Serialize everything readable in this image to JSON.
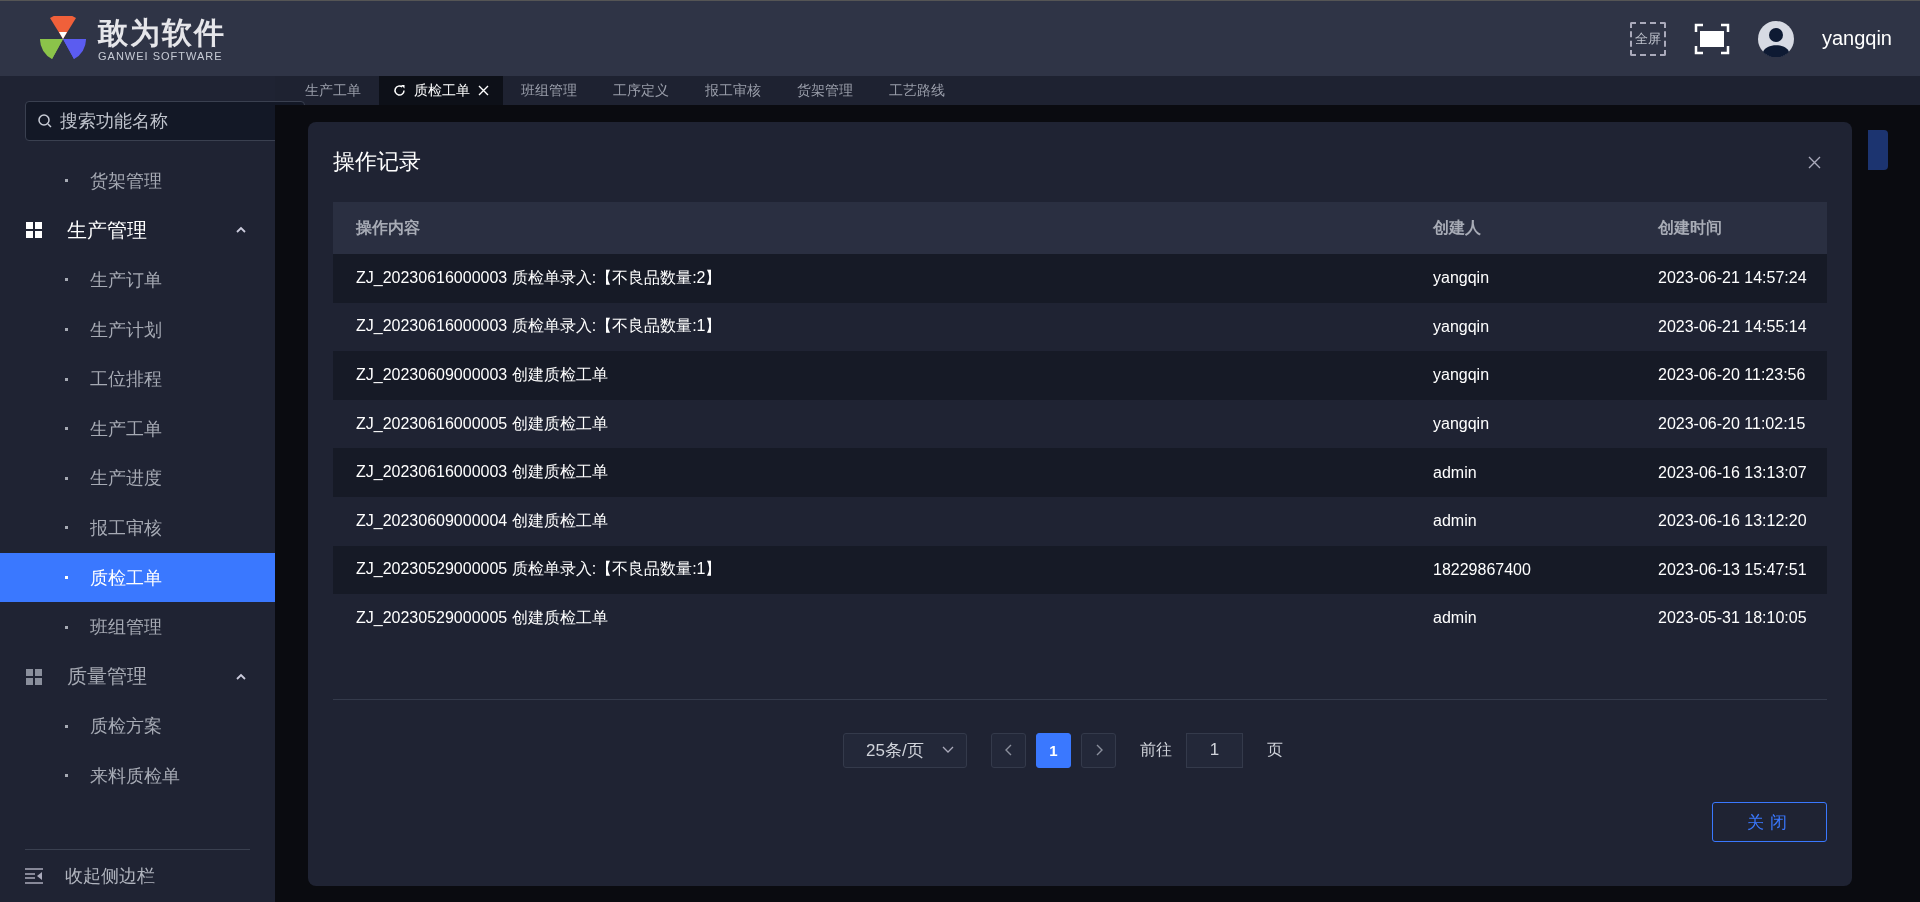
{
  "header": {
    "logo_title": "敢为软件",
    "logo_subtitle": "GANWEI SOFTWARE",
    "fullscreen_label": "全屏",
    "username": "yangqin"
  },
  "sidebar": {
    "search_placeholder": "搜索功能名称",
    "items": [
      {
        "kind": "leaf",
        "label": "货架管理",
        "selected": false
      },
      {
        "kind": "group",
        "label": "生产管理",
        "active": true,
        "expanded": true,
        "children": [
          {
            "kind": "leaf",
            "label": "生产订单",
            "selected": false
          },
          {
            "kind": "leaf",
            "label": "生产计划",
            "selected": false
          },
          {
            "kind": "leaf",
            "label": "工位排程",
            "selected": false
          },
          {
            "kind": "leaf",
            "label": "生产工单",
            "selected": false
          },
          {
            "kind": "leaf",
            "label": "生产进度",
            "selected": false
          },
          {
            "kind": "leaf",
            "label": "报工审核",
            "selected": false
          },
          {
            "kind": "leaf",
            "label": "质检工单",
            "selected": true
          },
          {
            "kind": "leaf",
            "label": "班组管理",
            "selected": false
          }
        ]
      },
      {
        "kind": "group",
        "label": "质量管理",
        "active": false,
        "expanded": true,
        "children": [
          {
            "kind": "leaf",
            "label": "质检方案",
            "selected": false
          },
          {
            "kind": "leaf",
            "label": "来料质检单",
            "selected": false
          }
        ]
      }
    ],
    "collapse_label": "收起侧边栏"
  },
  "tabs": [
    {
      "label": "生产工单",
      "selected": false
    },
    {
      "label": "质检工单",
      "selected": true
    },
    {
      "label": "班组管理",
      "selected": false
    },
    {
      "label": "工序定义",
      "selected": false
    },
    {
      "label": "报工审核",
      "selected": false
    },
    {
      "label": "货架管理",
      "selected": false
    },
    {
      "label": "工艺路线",
      "selected": false
    }
  ],
  "dialog": {
    "title": "操作记录",
    "columns": [
      "操作内容",
      "创建人",
      "创建时间"
    ],
    "rows": [
      {
        "content": "ZJ_20230616000003 质检单录入:【不良品数量:2】",
        "creator": "yangqin",
        "time": "2023-06-21 14:57:24"
      },
      {
        "content": "ZJ_20230616000003 质检单录入:【不良品数量:1】",
        "creator": "yangqin",
        "time": "2023-06-21 14:55:14"
      },
      {
        "content": "ZJ_20230609000003 创建质检工单",
        "creator": "yangqin",
        "time": "2023-06-20 11:23:56"
      },
      {
        "content": "ZJ_20230616000005 创建质检工单",
        "creator": "yangqin",
        "time": "2023-06-20 11:02:15"
      },
      {
        "content": "ZJ_20230616000003 创建质检工单",
        "creator": "admin",
        "time": "2023-06-16 13:13:07"
      },
      {
        "content": "ZJ_20230609000004 创建质检工单",
        "creator": "admin",
        "time": "2023-06-16 13:12:20"
      },
      {
        "content": "ZJ_20230529000005 质检单录入:【不良品数量:1】",
        "creator": "18229867400",
        "time": "2023-06-13 15:47:51"
      },
      {
        "content": "ZJ_20230529000005 创建质检工单",
        "creator": "admin",
        "time": "2023-05-31 18:10:05"
      }
    ],
    "pagination": {
      "page_size": "25条/页",
      "pages": [
        {
          "label": "1",
          "selected": true
        }
      ],
      "goto_label": "前往",
      "goto_value": "1",
      "page_suffix": "页"
    },
    "close_button": "关闭"
  }
}
